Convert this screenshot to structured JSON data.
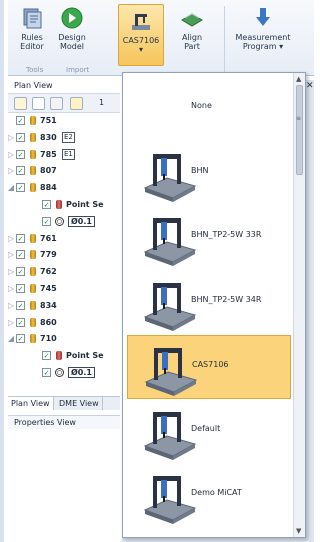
{
  "ribbon": {
    "buttons": [
      {
        "label": "Rules\nEditor",
        "icon": "rules-editor-icon"
      },
      {
        "label": "Design\nModel",
        "icon": "design-model-icon"
      },
      {
        "label": "CAS7106\n▾",
        "icon": "cmm-machine-icon"
      },
      {
        "label": "Align\nPart",
        "icon": "align-part-icon"
      },
      {
        "label": "Measurement\nProgram ▾",
        "icon": "measurement-program-icon"
      }
    ],
    "groups": [
      "Tools",
      "Import"
    ],
    "accent": "#f6c55c"
  },
  "plan_view": {
    "title": "Plan View",
    "toolbar_count": "1",
    "rows": [
      {
        "indent": 0,
        "expander": "",
        "checked": true,
        "icon": "part",
        "text": "751",
        "tag": ""
      },
      {
        "indent": 0,
        "expander": "▷",
        "checked": true,
        "icon": "part",
        "text": "830",
        "tag": "E2"
      },
      {
        "indent": 0,
        "expander": "▷",
        "checked": true,
        "icon": "part",
        "text": "785",
        "tag": "E1"
      },
      {
        "indent": 0,
        "expander": "▷",
        "checked": true,
        "icon": "part",
        "text": "807",
        "tag": ""
      },
      {
        "indent": 0,
        "expander": "◢",
        "checked": true,
        "icon": "part",
        "text": "884",
        "tag": ""
      },
      {
        "indent": 1,
        "expander": "",
        "checked": true,
        "icon": "point",
        "text": "Point Se",
        "tag": ""
      },
      {
        "indent": 1,
        "expander": "",
        "checked": true,
        "icon": "ring",
        "text": "Ø0.1",
        "tag": ""
      },
      {
        "indent": 0,
        "expander": "▷",
        "checked": true,
        "icon": "part",
        "text": "761",
        "tag": ""
      },
      {
        "indent": 0,
        "expander": "▷",
        "checked": true,
        "icon": "part",
        "text": "779",
        "tag": ""
      },
      {
        "indent": 0,
        "expander": "▷",
        "checked": true,
        "icon": "part",
        "text": "762",
        "tag": ""
      },
      {
        "indent": 0,
        "expander": "▷",
        "checked": true,
        "icon": "part",
        "text": "745",
        "tag": ""
      },
      {
        "indent": 0,
        "expander": "▷",
        "checked": true,
        "icon": "part",
        "text": "834",
        "tag": ""
      },
      {
        "indent": 0,
        "expander": "▷",
        "checked": true,
        "icon": "part",
        "text": "860",
        "tag": ""
      },
      {
        "indent": 0,
        "expander": "◢",
        "checked": true,
        "icon": "part",
        "text": "710",
        "tag": ""
      },
      {
        "indent": 1,
        "expander": "",
        "checked": true,
        "icon": "point",
        "text": "Point Se",
        "tag": ""
      },
      {
        "indent": 1,
        "expander": "",
        "checked": true,
        "icon": "ring",
        "text": "Ø0.1",
        "tag": ""
      }
    ]
  },
  "tabs": [
    "Plan View",
    "DME View"
  ],
  "properties_view": {
    "title": "Properties View"
  },
  "machine_dropdown": {
    "options": [
      {
        "label": "None",
        "has_thumb": false,
        "selected": false
      },
      {
        "label": "BHN",
        "has_thumb": true,
        "selected": false
      },
      {
        "label": "BHN_TP2-5W 33R",
        "has_thumb": true,
        "selected": false
      },
      {
        "label": "BHN_TP2-5W 34R",
        "has_thumb": true,
        "selected": false
      },
      {
        "label": "CAS7106",
        "has_thumb": true,
        "selected": true
      },
      {
        "label": "Default",
        "has_thumb": true,
        "selected": false
      },
      {
        "label": "Demo MiCAT",
        "has_thumb": true,
        "selected": false
      }
    ],
    "selected_color": "#fbd37a"
  }
}
